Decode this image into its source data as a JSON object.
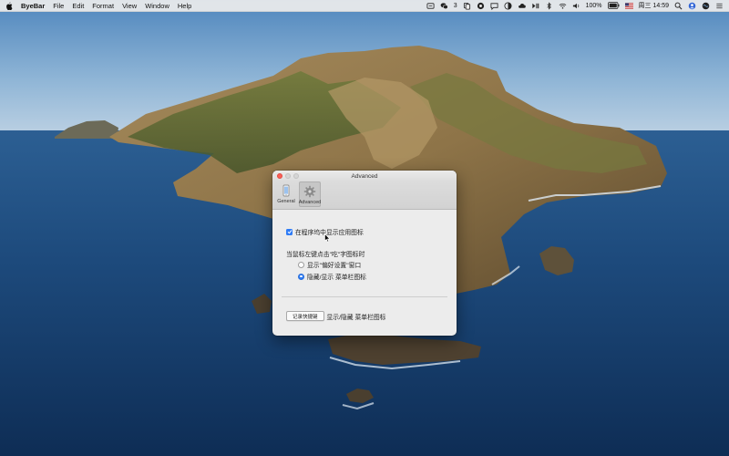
{
  "menubar": {
    "app_name": "ByeBar",
    "menus": [
      "File",
      "Edit",
      "Format",
      "View",
      "Window",
      "Help"
    ],
    "wechat_count": "3",
    "battery": "100%",
    "clock": "周三 14:59"
  },
  "window": {
    "title": "Advanced",
    "tabs": [
      {
        "label": "General",
        "icon": "phone-icon"
      },
      {
        "label": "Advanced",
        "icon": "gear-icon",
        "selected": true
      }
    ],
    "show_dock_icon_label": "在程序坞中显示应用图标",
    "show_dock_icon_checked": true,
    "left_click_label": "当鼠标左键点击\"吃\"字图标时",
    "radio_options": [
      {
        "label": "显示\"偏好设置\"窗口",
        "selected": false
      },
      {
        "label": "隐藏/显示 菜单栏图标",
        "selected": true
      }
    ],
    "record_shortcut_button": "记录快捷键",
    "shortcut_description": "显示/隐藏 菜单栏图标"
  },
  "colors": {
    "accent": "#2f7cf6",
    "close": "#fc5f57"
  }
}
